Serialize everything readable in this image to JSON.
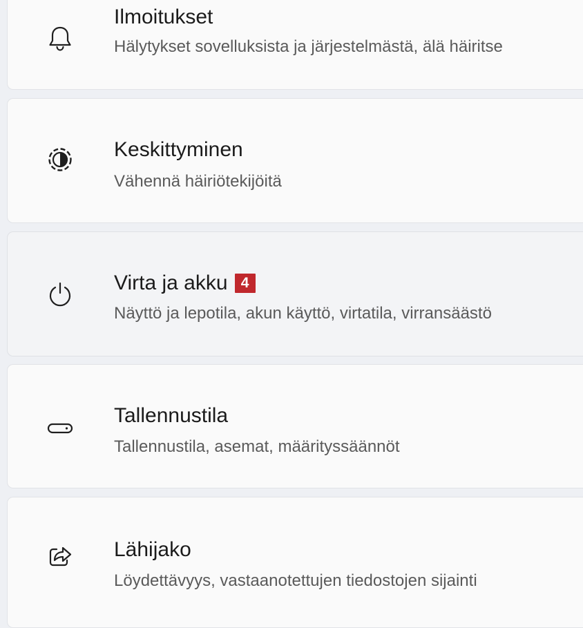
{
  "settings_list": {
    "items": [
      {
        "id": "ilmoitukset",
        "title": "Ilmoitukset",
        "subtitle": "Hälytykset sovelluksista ja järjestelmästä, älä häiritse",
        "icon": "bell-icon"
      },
      {
        "id": "keskittyminen",
        "title": "Keskittyminen",
        "subtitle": "Vähennä häiriötekijöitä",
        "icon": "focus-icon"
      },
      {
        "id": "virta-ja-akku",
        "title": "Virta ja akku",
        "badge": "4",
        "subtitle": "Näyttö ja lepotila, akun käyttö, virtatila, virransäästö",
        "icon": "power-icon"
      },
      {
        "id": "tallennustila",
        "title": "Tallennustila",
        "subtitle": "Tallennustila, asemat, määrityssäännöt",
        "icon": "storage-icon"
      },
      {
        "id": "lahijako",
        "title": "Lähijako",
        "subtitle": "Löydettävyys, vastaanotettujen tiedostojen sijainti",
        "icon": "share-icon"
      }
    ]
  },
  "colors": {
    "page_background": "#eef0f4",
    "card_background": "#fafafa",
    "card_hover_background": "#f3f4f6",
    "badge_background": "#c0282d",
    "title_text": "#1b1b1b",
    "subtitle_text": "#5a5a5a"
  }
}
